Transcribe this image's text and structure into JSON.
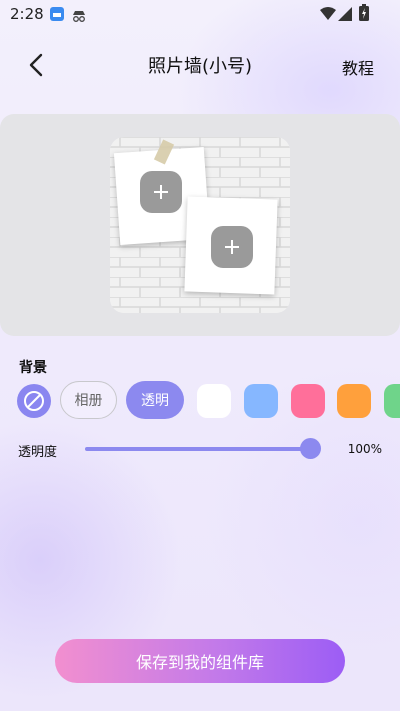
{
  "status_bar": {
    "time": "2:28"
  },
  "header": {
    "title": "照片墙(小号)",
    "tutorial": "教程"
  },
  "background_section": {
    "label": "背景",
    "album_label": "相册",
    "transparent_label": "透明",
    "swatches": [
      "#ffffff",
      "#86b7ff",
      "#ff6f9a",
      "#ffa03c",
      "#6fd48a"
    ],
    "accent": "#8c89ef"
  },
  "opacity": {
    "label": "透明度",
    "value_text": "100%",
    "level": 1.0
  },
  "save_button": {
    "label": "保存到我的组件库"
  }
}
